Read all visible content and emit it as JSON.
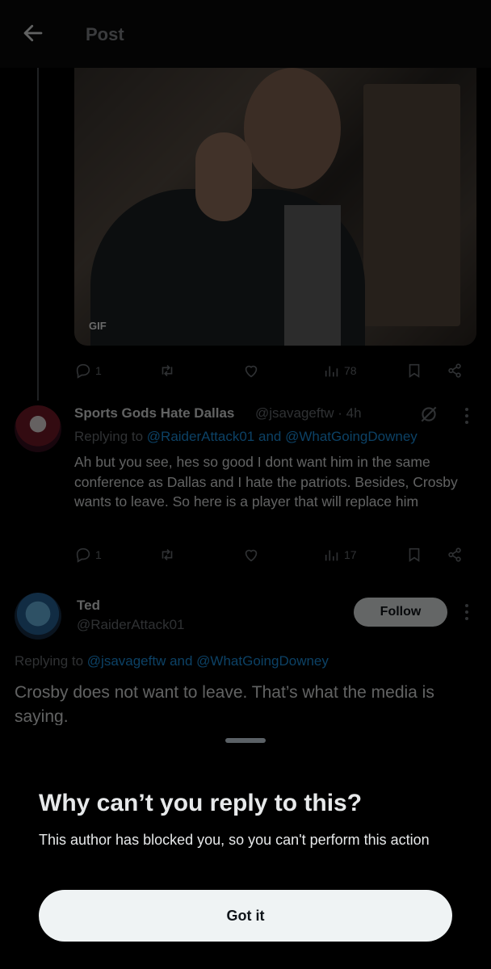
{
  "header": {
    "title": "Post"
  },
  "gif": {
    "badge": "GIF"
  },
  "first_post_actions": {
    "replies": "1",
    "retweets": "",
    "likes": "",
    "views": "78"
  },
  "reply1": {
    "display_name": "Sports Gods Hate Dallas",
    "handle_time": "@jsavageftw · 4h",
    "replying_prefix": "Replying to ",
    "replying_mentions": "@RaiderAttack01 and @WhatGoingDowney",
    "text": "Ah but you see, hes so good I dont want him in the same conference as Dallas and I hate the patriots. Besides, Crosby wants to leave. So here is a player that will replace him",
    "actions": {
      "replies": "1",
      "views": "17"
    }
  },
  "main_post": {
    "display_name": "Ted",
    "handle": "@RaiderAttack01",
    "follow_label": "Follow",
    "replying_prefix": "Replying to ",
    "replying_mentions": "@jsavageftw and @WhatGoingDowney",
    "text": "Crosby does not want to leave. That’s what the media is saying."
  },
  "sheet": {
    "title": "Why can’t you reply to this?",
    "description": "This author has blocked you, so you can't perform this action",
    "button_label": "Got it"
  },
  "colors": {
    "accent": "#1d9bf0",
    "muted": "#71767b",
    "button_bg": "#eff3f4"
  }
}
